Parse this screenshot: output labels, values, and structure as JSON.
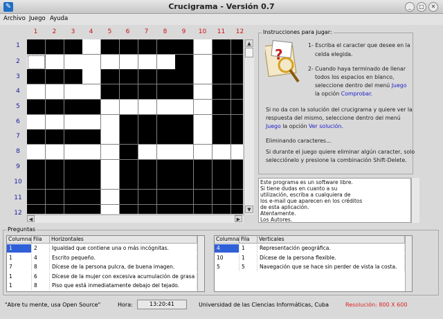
{
  "window": {
    "title": "Crucigrama - Versión 0.7"
  },
  "menu": [
    {
      "label": "Archivo"
    },
    {
      "label": "Juego"
    },
    {
      "label": "Ayuda"
    }
  ],
  "columns": [
    "1",
    "2",
    "3",
    "4",
    "5",
    "6",
    "7",
    "8",
    "9",
    "10",
    "11",
    "12"
  ],
  "rows": [
    "1",
    "2",
    "3",
    "4",
    "5",
    "6",
    "7",
    "8",
    "9",
    "10",
    "11",
    "12"
  ],
  "grid": [
    "BBBWBBBBBWBB",
    "WWWWWWWWBWBB",
    "BBBWBBBBBWBB",
    "WWWWBBBBBWBB",
    "BBBBWWWWWWBB",
    "WWWWWBBBBWBB",
    "BBBBWBBBBWBB",
    "WWWWWBWWWWWW",
    "BBBBWBBBBBBB",
    "BBBBWBBBBBBB",
    "BBBBWBBBBBBB",
    "BBBBWBBBBBBB"
  ],
  "instructions": {
    "title": "Instrucciones para jugar:",
    "step1": "1- Escriba el caracter que desee en la",
    "step1b": "celda elegida.",
    "step2": "2- Cuando haya terminado de llenar",
    "step2b": "todos los espacios en blanco,",
    "step2c": "seleccione dentro del menú",
    "step2c_link": "Juego",
    "step2d": "la opción",
    "step2d_link": "Comprobar.",
    "solution1": "Si no da con la solución del crucigrama y quiere ver la",
    "solution2": "respuesta del mismo, seleccione dentro del menú",
    "solution3_link1": "Juego",
    "solution3": " la opción ",
    "solution3_link2": "Ver solución.",
    "delete_title": "Eliminando caracteres...",
    "delete1": "Si durante el juego quiere eliminar algún caracter, solo",
    "delete2": "selecciónelo y presione la combinación Shift-Delete."
  },
  "about": [
    "Este programa es un software libre.",
    "Si tiene dudas en cuanto a su",
    "utilización, escriba a cualquiera de",
    "los e-mail que aparecen en los créditos",
    "de esta aplicación.",
    "Atentamente.",
    "Los Autores."
  ],
  "questions": {
    "label": "Preguntas",
    "horizontal": {
      "headers": [
        "Columna",
        "Fila",
        "Horizontales"
      ],
      "rows": [
        [
          "1",
          "2",
          "Igualdad que contiene una o más incógnitas."
        ],
        [
          "1",
          "4",
          "Escrito pequeño."
        ],
        [
          "7",
          "8",
          "Dícese de la persona pulcra, de buena imagen."
        ],
        [
          "1",
          "6",
          "Dícese de la mujer con excesiva acumulación de grasa en"
        ],
        [
          "1",
          "8",
          "Piso que está inmediatamente debajo del tejado."
        ]
      ]
    },
    "vertical": {
      "headers": [
        "Columna",
        "Fila",
        "Verticales"
      ],
      "rows": [
        [
          "4",
          "1",
          "Representación geográfica."
        ],
        [
          "10",
          "1",
          "Dícese de la persona flexible."
        ],
        [
          "5",
          "5",
          "Navegación que se hace sin perder de vista la costa."
        ]
      ]
    }
  },
  "status": {
    "slogan": "\"Abre tu mente, usa Open Source\"",
    "time_label": "Hora:",
    "time": "13:20:41",
    "university": "Universidad de las Ciencias Informáticas, Cuba",
    "resolution": "Resolución: 800 X 600"
  },
  "colors": {
    "column_numbers": "#cc1111",
    "row_numbers": "#1a1aa0",
    "links": "#1a1acc",
    "resolution": "#dd2222",
    "selection": "#3060d8"
  }
}
